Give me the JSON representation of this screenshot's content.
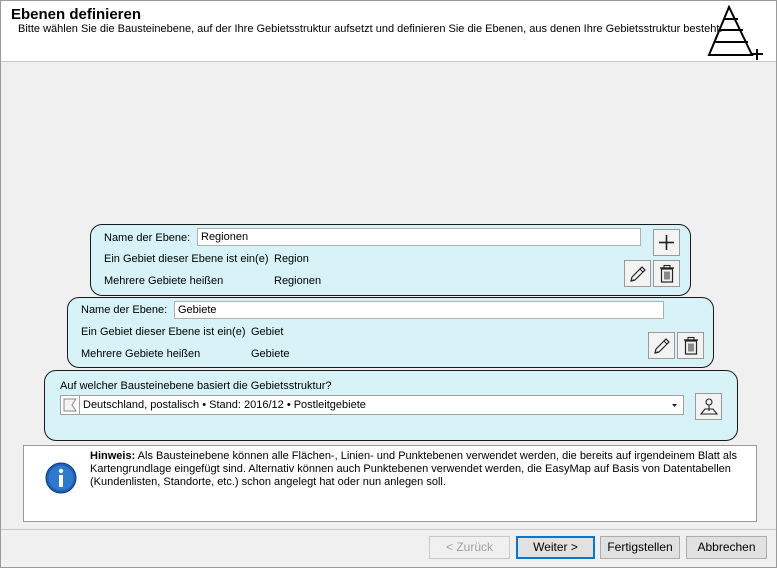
{
  "header": {
    "title": "Ebenen definieren",
    "subtitle": "Bitte wählen Sie die Bausteinebene, auf der Ihre Gebietsstruktur aufsetzt und definieren Sie die Ebenen, aus denen Ihre Gebietsstruktur besteht.",
    "icon": "pyramid-plus-icon"
  },
  "levels": [
    {
      "name_label": "Name der Ebene:",
      "name_value": "Regionen",
      "singular_label": "Ein Gebiet dieser Ebene ist ein(e)",
      "singular_value": "Region",
      "plural_label": "Mehrere Gebiete heißen",
      "plural_value": "Regionen"
    },
    {
      "name_label": "Name der Ebene:",
      "name_value": "Gebiete",
      "singular_label": "Ein Gebiet dieser Ebene ist ein(e)",
      "singular_value": "Gebiet",
      "plural_label": "Mehrere Gebiete heißen",
      "plural_value": "Gebiete"
    }
  ],
  "base": {
    "question": "Auf welcher Bausteinebene basiert die Gebietsstruktur?",
    "selected": "Deutschland, postalisch • Stand: 2016/12 • Postleitgebiete"
  },
  "note": {
    "label": "Hinweis:",
    "text": " Als Bausteinebene können alle Flächen-, Linien- und Punktebenen verwendet werden, die bereits auf irgendeinem Blatt als Kartengrundlage eingefügt sind. Alternativ können auch Punktebenen verwendet werden, die EasyMap auf Basis von Datentabellen (Kundenlisten,  Standorte, etc.) schon angelegt hat oder nun anlegen soll."
  },
  "buttons": {
    "back": "< Zurück",
    "next": "Weiter >",
    "finish": "Fertigstellen",
    "cancel": "Abbrechen"
  },
  "colors": {
    "level_bg": "#d7f3f7",
    "header_bg": "#ffffff",
    "dialog_bg": "#f0f0f0",
    "focus_border": "#0078d7"
  }
}
